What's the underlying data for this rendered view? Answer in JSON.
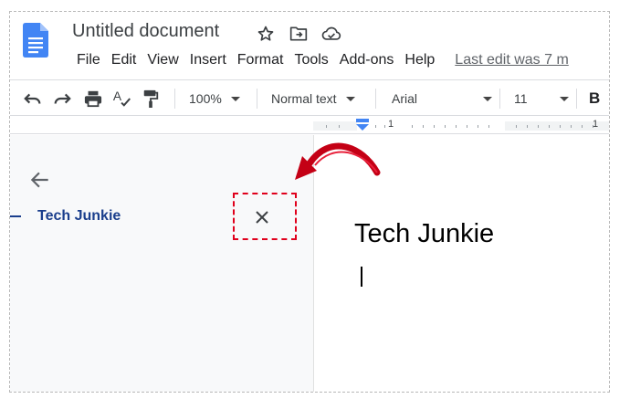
{
  "app": {
    "doc_title": "Untitled document",
    "icons": [
      "docs-logo-icon",
      "star-icon",
      "move-to-folder-icon",
      "cloud-status-icon"
    ]
  },
  "menubar": {
    "items": [
      "File",
      "Edit",
      "View",
      "Insert",
      "Format",
      "Tools",
      "Add-ons",
      "Help"
    ],
    "last_edit": "Last edit was 7 m"
  },
  "toolbar": {
    "zoom": "100%",
    "style": "Normal text",
    "font": "Arial",
    "size": "11",
    "bold_label": "B",
    "icons": [
      "undo-icon",
      "redo-icon",
      "print-icon",
      "spellcheck-icon",
      "paint-format-icon"
    ]
  },
  "ruler": {
    "label_left": "1",
    "label_right": "1"
  },
  "outline": {
    "heading": "Tech Junkie"
  },
  "document": {
    "heading": "Tech Junkie"
  },
  "colors": {
    "outline_heading": "#1a3e8c",
    "annotation": "#d0021b",
    "accent_blue": "#4285f4"
  }
}
